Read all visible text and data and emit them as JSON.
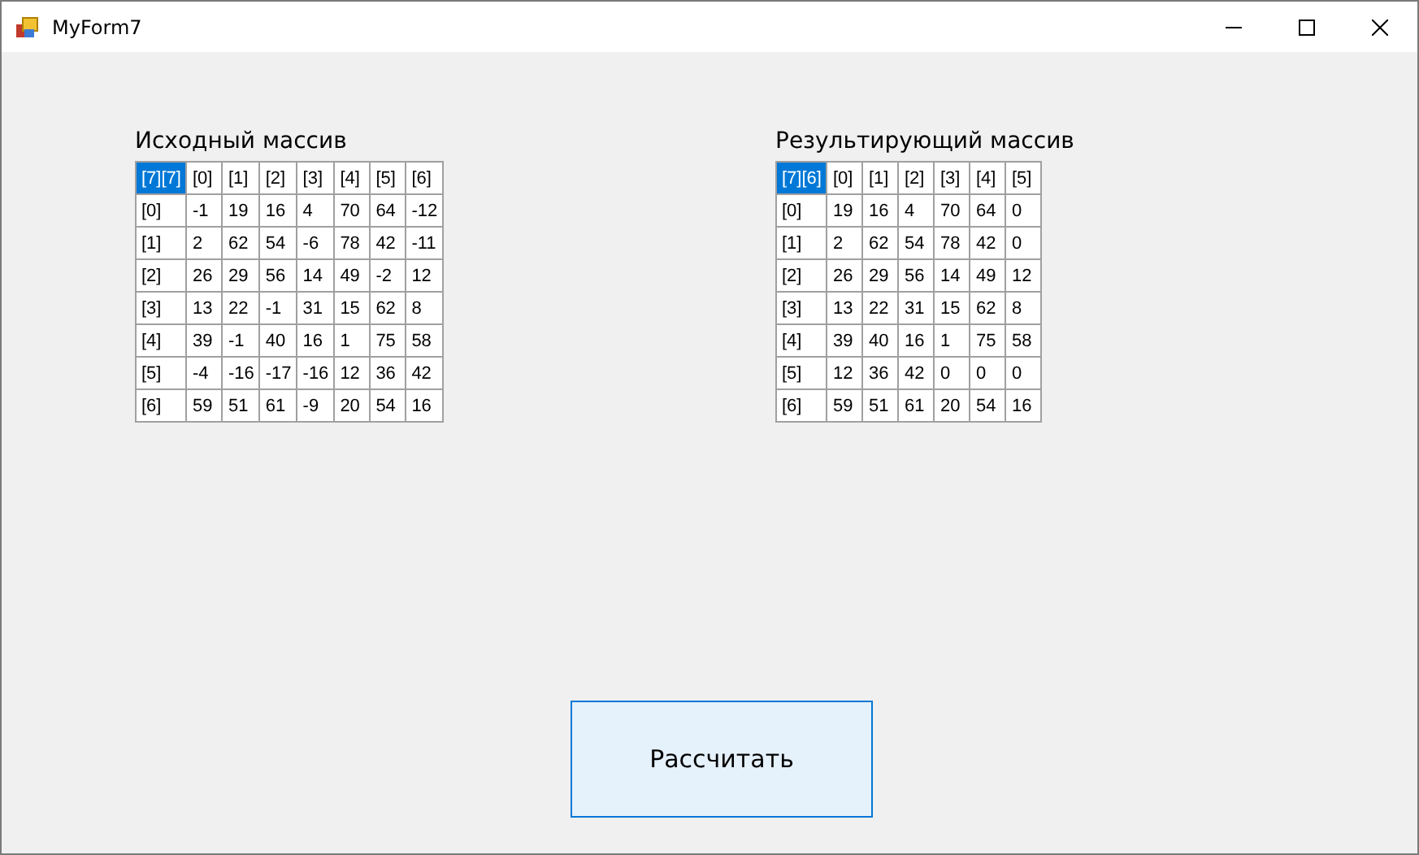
{
  "window": {
    "title": "MyForm7"
  },
  "grids": [
    {
      "label": "Исходный массив",
      "corner": {
        "text": "[7][7]",
        "selected": true
      },
      "columns": [
        "[0]",
        "[1]",
        "[2]",
        "[3]",
        "[4]",
        "[5]",
        "[6]"
      ],
      "rows": [
        {
          "header": "[0]",
          "cells": [
            "-1",
            "19",
            "16",
            "4",
            "70",
            "64",
            "-12"
          ]
        },
        {
          "header": "[1]",
          "cells": [
            "2",
            "62",
            "54",
            "-6",
            "78",
            "42",
            "-11"
          ]
        },
        {
          "header": "[2]",
          "cells": [
            "26",
            "29",
            "56",
            "14",
            "49",
            "-2",
            "12"
          ]
        },
        {
          "header": "[3]",
          "cells": [
            "13",
            "22",
            "-1",
            "31",
            "15",
            "62",
            "8"
          ]
        },
        {
          "header": "[4]",
          "cells": [
            "39",
            "-1",
            "40",
            "16",
            "1",
            "75",
            "58"
          ]
        },
        {
          "header": "[5]",
          "cells": [
            "-4",
            "-16",
            "-17",
            "-16",
            "12",
            "36",
            "42"
          ]
        },
        {
          "header": "[6]",
          "cells": [
            "59",
            "51",
            "61",
            "-9",
            "20",
            "54",
            "16"
          ]
        }
      ]
    },
    {
      "label": "Результирующий массив",
      "corner": {
        "text": "[7][6]",
        "selected": true
      },
      "columns": [
        "[0]",
        "[1]",
        "[2]",
        "[3]",
        "[4]",
        "[5]"
      ],
      "rows": [
        {
          "header": "[0]",
          "cells": [
            "19",
            "16",
            "4",
            "70",
            "64",
            "0"
          ]
        },
        {
          "header": "[1]",
          "cells": [
            "2",
            "62",
            "54",
            "78",
            "42",
            "0"
          ]
        },
        {
          "header": "[2]",
          "cells": [
            "26",
            "29",
            "56",
            "14",
            "49",
            "12"
          ]
        },
        {
          "header": "[3]",
          "cells": [
            "13",
            "22",
            "31",
            "15",
            "62",
            "8"
          ]
        },
        {
          "header": "[4]",
          "cells": [
            "39",
            "40",
            "16",
            "1",
            "75",
            "58"
          ]
        },
        {
          "header": "[5]",
          "cells": [
            "12",
            "36",
            "42",
            "0",
            "0",
            "0"
          ]
        },
        {
          "header": "[6]",
          "cells": [
            "59",
            "51",
            "61",
            "20",
            "54",
            "16"
          ]
        }
      ]
    }
  ],
  "button": {
    "label": "Рассчитать"
  }
}
